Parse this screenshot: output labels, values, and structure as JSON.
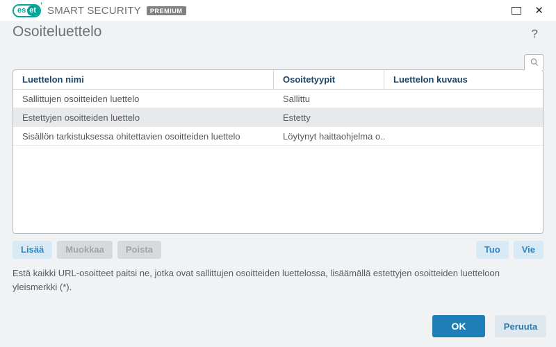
{
  "titlebar": {
    "logo_es": "es",
    "logo_et": "et",
    "product": "SMART SECURITY",
    "tier": "PREMIUM",
    "close_glyph": "✕"
  },
  "header": {
    "title": "Osoiteluettelo",
    "help_glyph": "?"
  },
  "table": {
    "columns": {
      "name": "Luettelon nimi",
      "type": "Osoitetyypit",
      "desc": "Luettelon kuvaus"
    },
    "rows": [
      {
        "name": "Sallittujen osoitteiden luettelo",
        "type": "Sallittu",
        "desc": ""
      },
      {
        "name": "Estettyjen osoitteiden luettelo",
        "type": "Estetty",
        "desc": ""
      },
      {
        "name": "Sisällön tarkistuksessa ohitettavien osoitteiden luettelo",
        "type": "Löytynyt haittaohjelma o...",
        "desc": ""
      }
    ]
  },
  "actions": {
    "add": "Lisää",
    "edit": "Muokkaa",
    "delete": "Poista",
    "import": "Tuo",
    "export": "Vie"
  },
  "description": "Estä kaikki URL-osoitteet paitsi ne, jotka ovat sallittujen osoitteiden luettelossa, lisäämällä estettyjen osoitteiden luetteloon yleismerkki (*).",
  "footer": {
    "ok": "OK",
    "cancel": "Peruuta"
  },
  "icons": {
    "search": "magnifier",
    "maximize": "square-outline",
    "help": "question-mark"
  },
  "colors": {
    "eset_teal": "#00a596",
    "header_text": "#1d4567",
    "accent_blue": "#2e86c1",
    "primary_button_bg": "#1f7db8",
    "disabled_button_bg": "#d8d9da",
    "selected_row_bg": "#e8e9ea",
    "content_bg": "#f0f2f3"
  }
}
